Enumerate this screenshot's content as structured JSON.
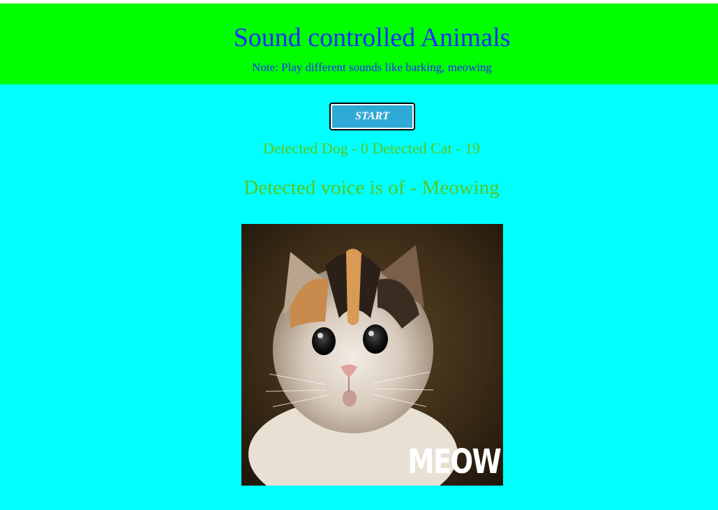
{
  "header": {
    "title": "Sound controlled Animals",
    "note": "Note: Play different sounds like barking, meowing"
  },
  "controls": {
    "start_label": "START"
  },
  "status": {
    "counts_text": "Detected Dog - 0 Detected Cat - 19",
    "detected_text": "Detected voice is of - Meowing"
  },
  "image": {
    "overlay_text": "MEOW"
  },
  "colors": {
    "header_bg": "#00ff00",
    "main_bg": "#00ffff",
    "title_text": "#1f2dff",
    "status_text": "#54c81e",
    "button_bg": "#2fa9d6"
  }
}
